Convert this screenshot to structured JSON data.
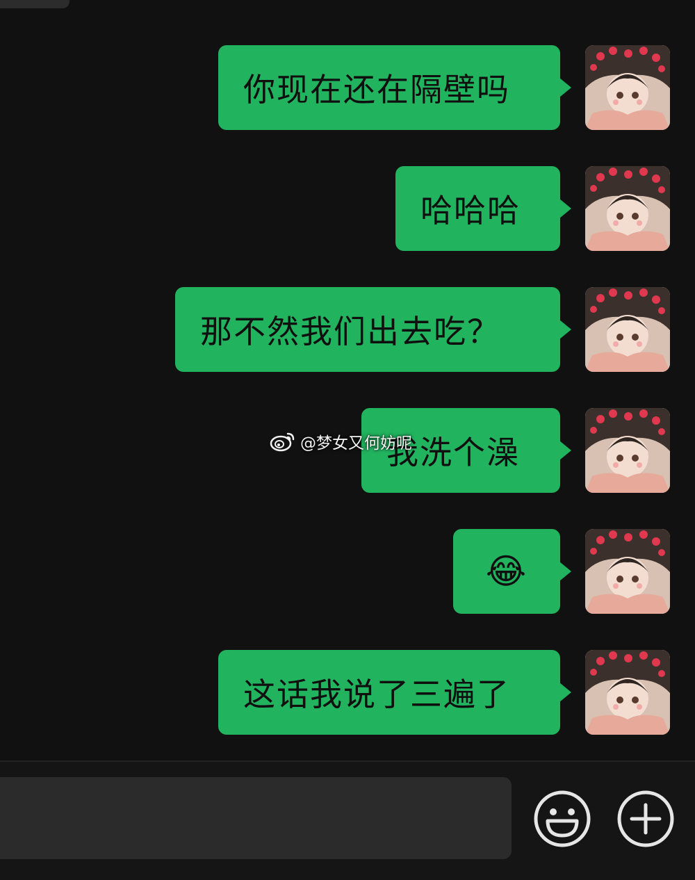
{
  "chat": {
    "messages": [
      {
        "text": "你现在还在隔壁吗",
        "sender": "self"
      },
      {
        "text": "哈哈哈",
        "sender": "self"
      },
      {
        "text": "那不然我们出去吃？",
        "sender": "self"
      },
      {
        "text": "我洗个澡",
        "sender": "self"
      },
      {
        "text": "😂",
        "sender": "self"
      },
      {
        "text": "这话我说了三遍了",
        "sender": "self"
      }
    ]
  },
  "watermark": {
    "text": "@梦女又何妨呢"
  },
  "input_bar": {
    "value": "",
    "emoji_icon": "smiley-face-icon",
    "plus_icon": "plus-circle-icon"
  },
  "colors": {
    "background": "#111111",
    "bubble": "#22b35f",
    "input": "#2b2b2b",
    "icon": "#e6e6e6"
  }
}
